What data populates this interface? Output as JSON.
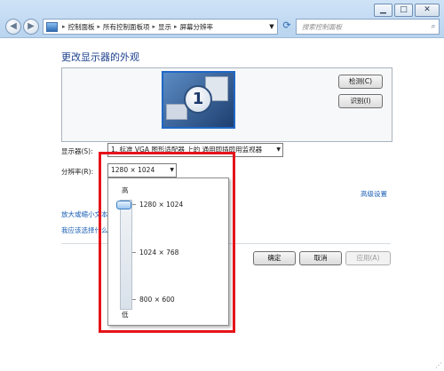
{
  "window": {
    "breadcrumbs": [
      "控制面板",
      "所有控制面板项",
      "显示",
      "屏幕分辨率"
    ],
    "search_placeholder": "搜索控制面板",
    "controls": {
      "minimize": "▁",
      "maximize": "□",
      "close": "✕"
    },
    "nav": {
      "back": "◀",
      "forward": "▶",
      "dropdown": "▼",
      "refresh": "⟳"
    }
  },
  "page": {
    "title": "更改显示器的外观",
    "monitor_number": "1",
    "detect_button": "检测(C)",
    "identify_button": "识别(I)",
    "display_label": "显示器(S):",
    "display_value": "1. 标准 VGA 图形适配器 上的 通用即插即用监视器",
    "resolution_label": "分辨率(R):",
    "resolution_value": "1280 × 1024",
    "advanced_link": "高级设置",
    "link_enlarge": "放大或缩小文本",
    "link_which": "我应该选择什么",
    "ok_button": "确定",
    "cancel_button": "取消",
    "apply_button": "应用(A)"
  },
  "resolution_slider": {
    "high_label": "高",
    "low_label": "低",
    "options": [
      "1280 × 1024",
      "1024 × 768",
      "800 × 600"
    ],
    "selected": "1280 × 1024"
  },
  "colors": {
    "titlebar": "#cfe3f7",
    "title_text": "#1c3f8c",
    "link": "#1a5fb4",
    "highlight_box": "#e5141a",
    "monitor_border": "#1f67c6"
  },
  "icons": [
    "control-panel-icon",
    "search-icon",
    "refresh-icon",
    "back-arrow-icon",
    "forward-arrow-icon"
  ]
}
